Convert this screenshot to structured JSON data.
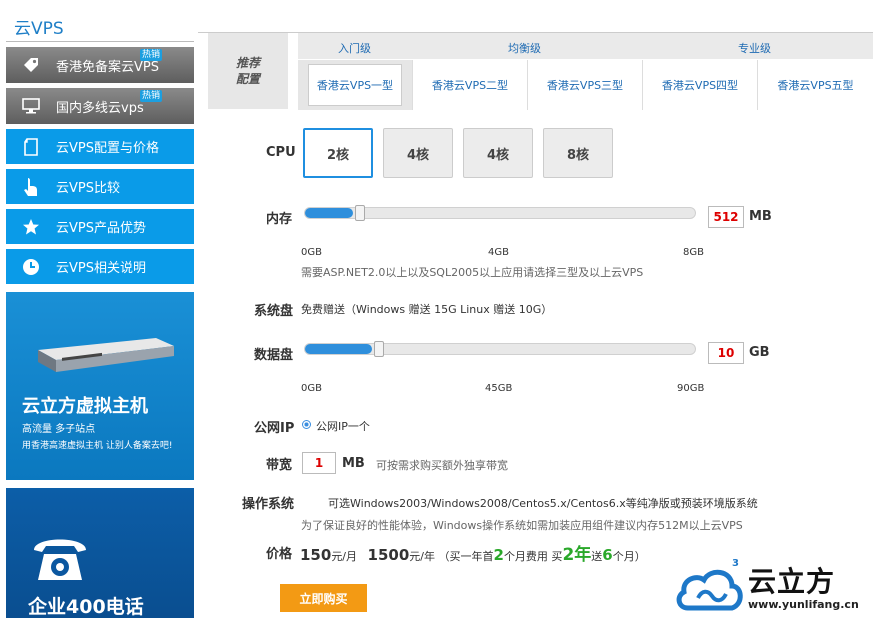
{
  "sidebar": {
    "title": "云VPS",
    "gray_items": [
      {
        "label": "香港免备案云VPS",
        "badge": "热销",
        "icon": "tag-icon"
      },
      {
        "label": "国内多线云vps",
        "badge": "热销",
        "icon": "monitor-icon"
      }
    ],
    "blue_items": [
      {
        "label": "云VPS配置与价格",
        "icon": "document-icon"
      },
      {
        "label": "云VPS比较",
        "icon": "pointer-hand-icon"
      },
      {
        "label": "云VPS产品优势",
        "icon": "star-icon"
      },
      {
        "label": "云VPS相关说明",
        "icon": "clock-icon"
      }
    ],
    "ad1": {
      "title": "云立方虚拟主机",
      "line1": "高流量 多子站点",
      "line2": "用香港高速虚拟主机 让别人备案去吧!"
    },
    "ad2": {
      "title": "企业400电话"
    }
  },
  "tabs": {
    "head_line1": "推荐",
    "head_line2": "配置",
    "levels": [
      "入门级",
      "均衡级",
      "专业级"
    ],
    "plans": [
      "香港云VPS一型",
      "香港云VPS二型",
      "香港云VPS三型",
      "香港云VPS四型",
      "香港云VPS五型"
    ],
    "active_plan": 0
  },
  "config": {
    "cpu": {
      "label": "CPU",
      "options": [
        "2核",
        "4核",
        "4核",
        "8核"
      ],
      "selected": 0
    },
    "memory": {
      "label": "内存",
      "value": "512",
      "unit": "MB",
      "ticks": [
        "0GB",
        "4GB",
        "8GB"
      ],
      "fill_fraction": 0.0625,
      "note": "需要ASP.NET2.0以上以及SQL2005以上应用请选择三型及以上云VPS"
    },
    "system_disk": {
      "label": "系统盘",
      "text": "免费赠送（Windows 赠送 15G Linux 赠送 10G）"
    },
    "data_disk": {
      "label": "数据盘",
      "value": "10",
      "unit": "GB",
      "ticks": [
        "0GB",
        "45GB",
        "90GB"
      ],
      "fill_fraction": 0.111
    },
    "public_ip": {
      "label": "公网IP",
      "option": "公网IP一个"
    },
    "bandwidth": {
      "label": "带宽",
      "value": "1",
      "unit": "MB",
      "note": "可按需求购买额外独享带宽"
    },
    "os": {
      "label": "操作系统",
      "text": "可选Windows2003/Windows2008/Centos5.x/Centos6.x等纯净版或预装环境版系统",
      "note": "为了保证良好的性能体验，Windows操作系统如需加装应用组件建议内存512M以上云VPS"
    },
    "price": {
      "label": "价格",
      "monthly": "150",
      "monthly_unit": "元/月",
      "yearly": "1500",
      "yearly_unit": "元/年",
      "promo_prefix": "（买一年首",
      "promo_n1": "2",
      "promo_mid1": "个月费用 买",
      "promo_n2": "2年",
      "promo_mid2": "送",
      "promo_n3": "6",
      "promo_suffix": "个月）"
    },
    "buy_label": "立即购买"
  },
  "logo": {
    "brand": "云立方",
    "url": "www.yunlifang.cn",
    "superscript": "3"
  },
  "colors": {
    "blue": "#0a9be8",
    "orange": "#f39a14",
    "red_value": "#dd0000",
    "green_promo": "#2aa82a"
  }
}
